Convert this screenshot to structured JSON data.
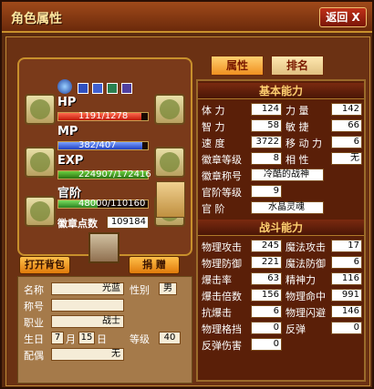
{
  "window": {
    "title": "角色属性",
    "close_label": "返回",
    "close_icon": "X"
  },
  "tabs": [
    {
      "label": "属性"
    },
    {
      "label": "排名"
    }
  ],
  "left": {
    "hp_label": "HP",
    "hp_value": "1191/1278",
    "hp_fraction": 0.93,
    "mp_label": "MP",
    "mp_value": "382/407",
    "mp_fraction": 0.94,
    "exp_label": "EXP",
    "exp_value": "224907/172416",
    "rank_label": "官阶",
    "rank_value": "48000/110160",
    "badge_points_label": "徽章点数",
    "badge_points_value": "109184",
    "open_bag": "打开背包",
    "gift": "捐 赠"
  },
  "info": {
    "name_label": "名称",
    "name_value": "光蓝",
    "gender_label": "性别",
    "gender_value": "男",
    "title_label": "称号",
    "title_value": "",
    "job_label": "职业",
    "job_value": "战士",
    "birth_label": "生日",
    "birth_month": "7",
    "month_unit": "月",
    "birth_day": "15",
    "day_unit": "日",
    "level_label": "等级",
    "level_value": "40",
    "spouse_label": "配偶",
    "spouse_value": "无"
  },
  "basic": {
    "title": "基本能力",
    "rows": [
      {
        "l1": "体   力",
        "v1": "124",
        "l2": "力   量",
        "v2": "142"
      },
      {
        "l1": "智   力",
        "v1": "58",
        "l2": "敏   捷",
        "v2": "66"
      },
      {
        "l1": "速   度",
        "v1": "3722",
        "l2": "移 动 力",
        "v2": "6"
      },
      {
        "l1": "徽章等级",
        "v1": "8",
        "l2": "相   性",
        "v2": "无"
      }
    ],
    "badge_title_label": "徽章称号",
    "badge_title_value": "冷酷的战神",
    "rank_level_label": "官阶等级",
    "rank_level_value": "9",
    "rank_label": "官   阶",
    "rank_value": "水晶灵魂"
  },
  "combat": {
    "title": "战斗能力",
    "rows": [
      {
        "l1": "物理攻击",
        "v1": "245",
        "l2": "魔法攻击",
        "v2": "17"
      },
      {
        "l1": "物理防御",
        "v1": "221",
        "l2": "魔法防御",
        "v2": "6"
      },
      {
        "l1": "爆击率",
        "v1": "63",
        "l2": "精神力",
        "v2": "116"
      },
      {
        "l1": "爆击倍数",
        "v1": "156",
        "l2": "物理命中",
        "v2": "991"
      },
      {
        "l1": "抗爆击",
        "v1": "6",
        "l2": "物理闪避",
        "v2": "146"
      },
      {
        "l1": "物理格挡",
        "v1": "0",
        "l2": "反弹",
        "v2": "0"
      }
    ],
    "rebound_label": "反弹伤害",
    "rebound_value": "0"
  },
  "colors": {
    "hp": "#e83020",
    "mp": "#3a6ae0",
    "exp": "#3aa020",
    "rank": "#40c040"
  }
}
